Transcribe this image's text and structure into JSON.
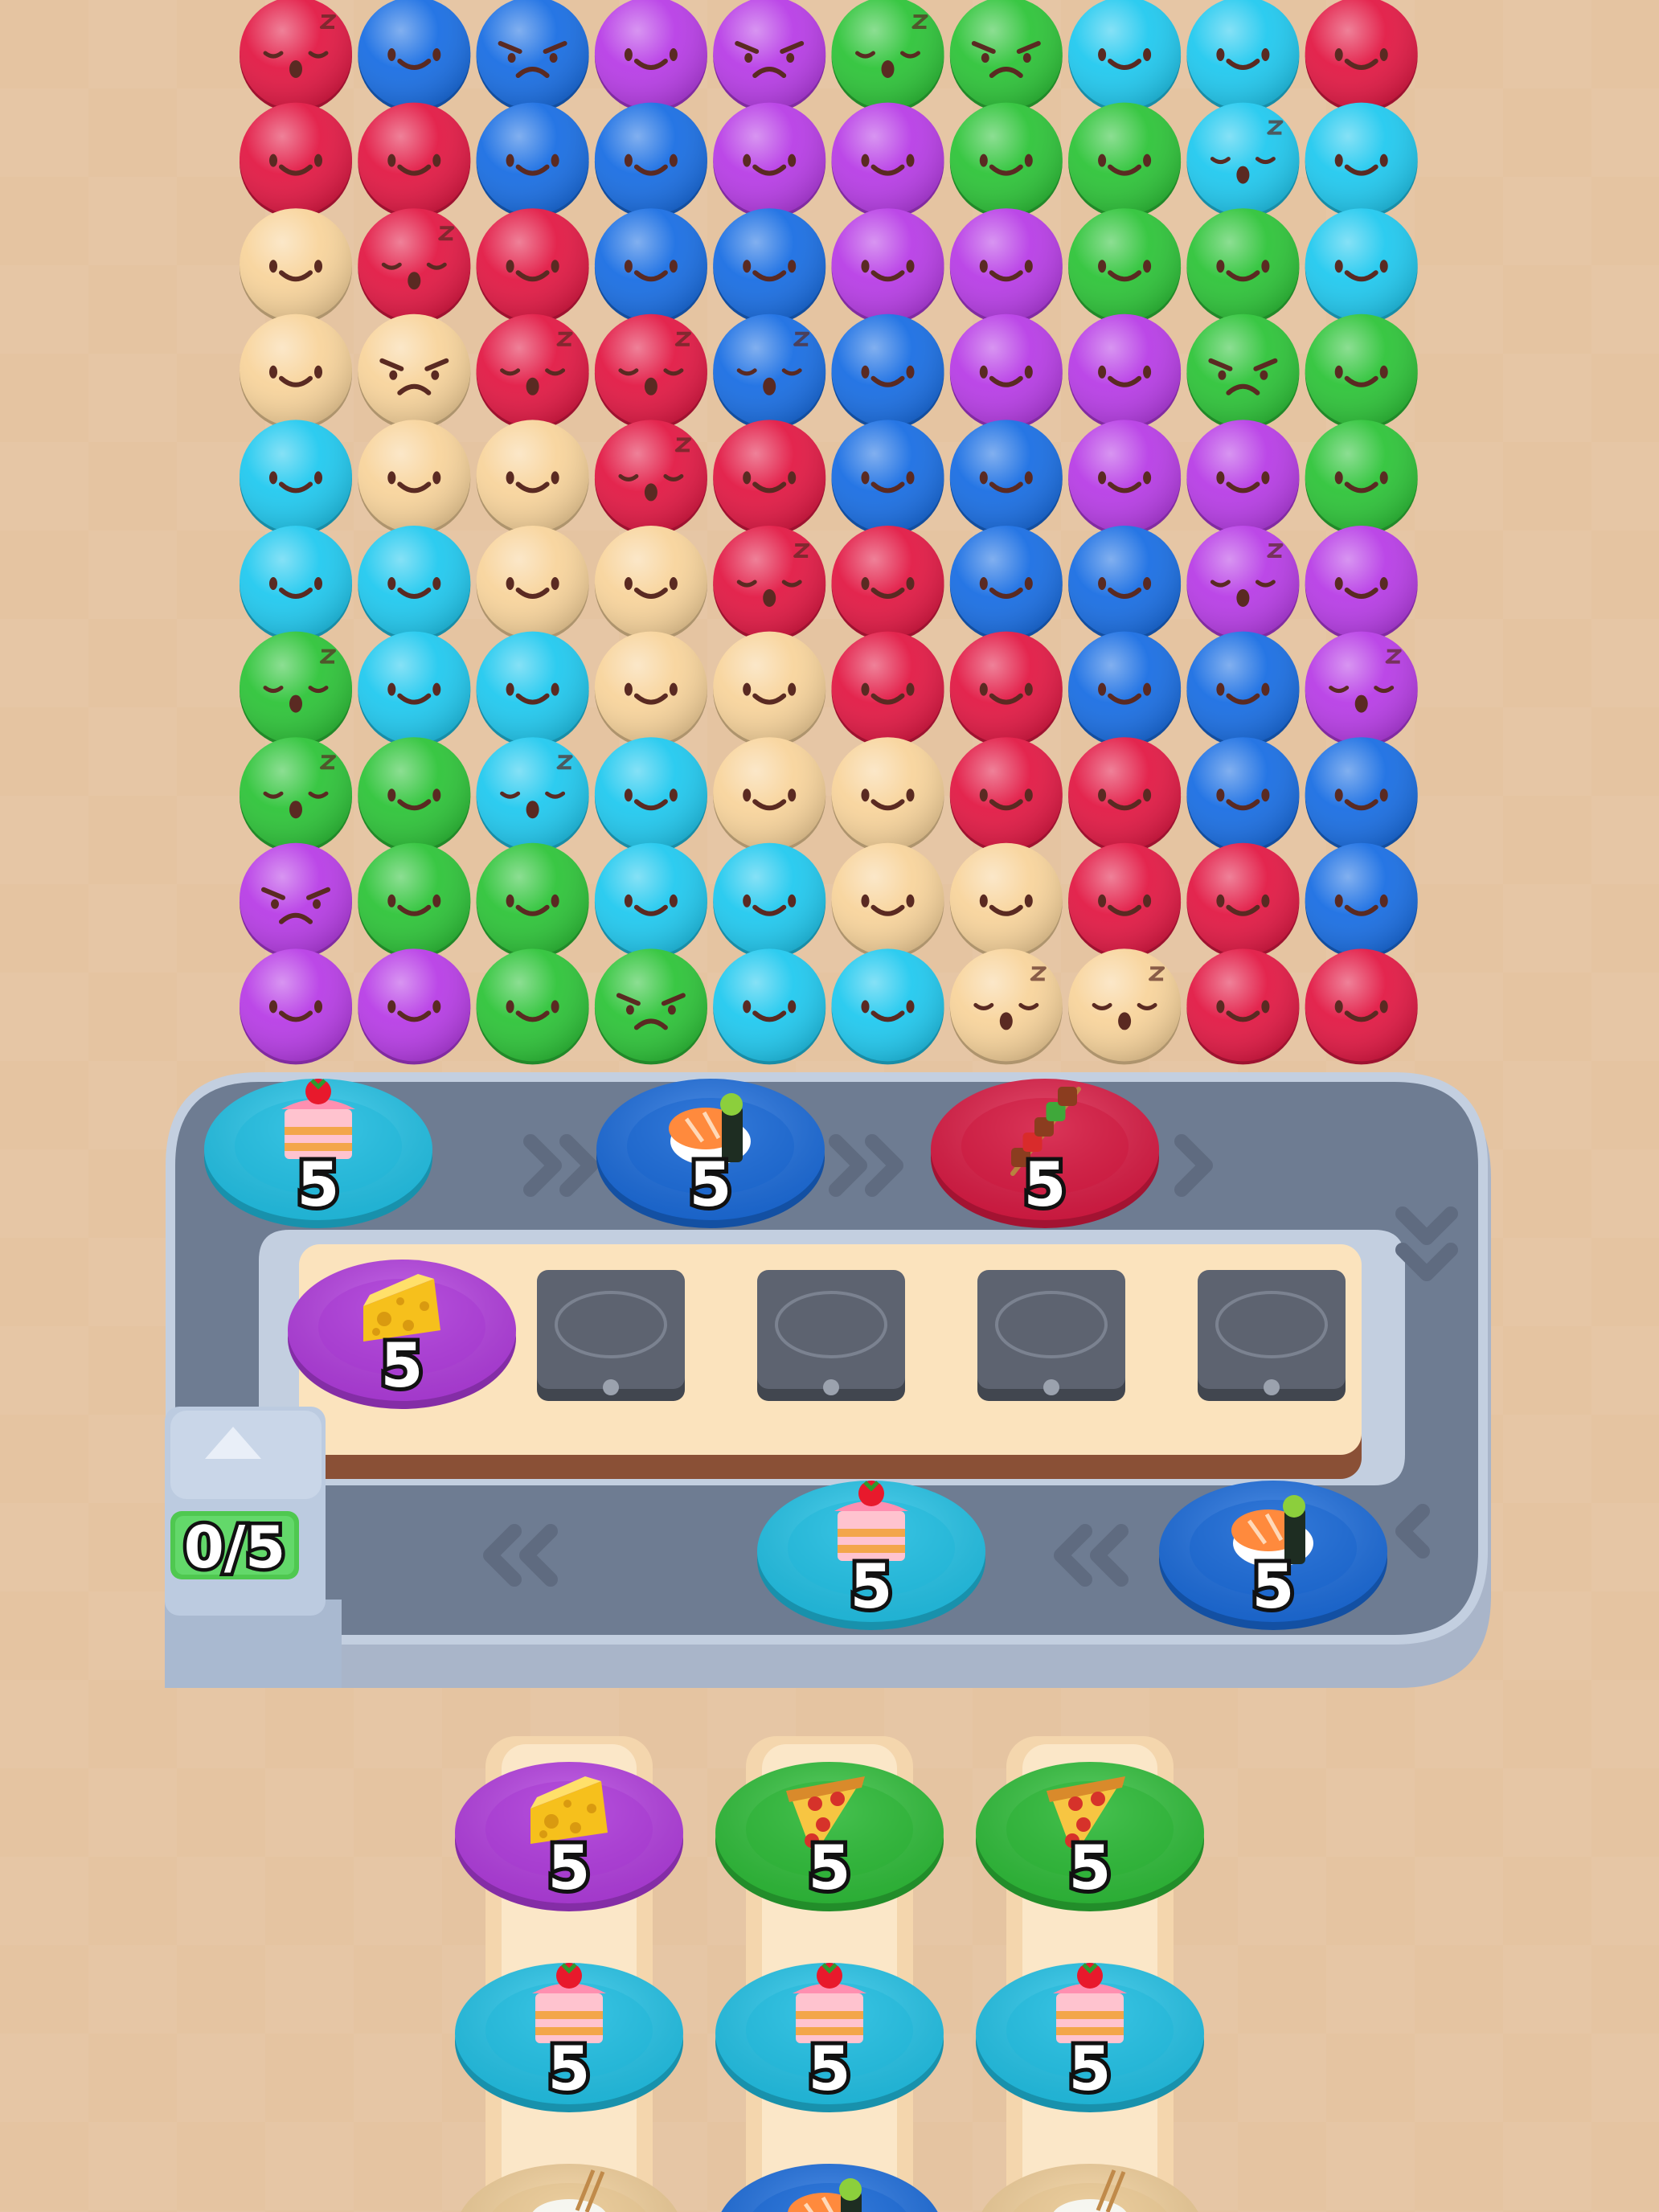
{
  "palette": {
    "red": "#e21a45",
    "blue": "#1b6fe3",
    "purple": "#b83ee6",
    "green": "#2fc43a",
    "cyan": "#22c9ef",
    "yellow": "#f8d49c",
    "background": "#e5c4a1",
    "belt": "#6e7c92",
    "belt_rail": "#b9c6da",
    "tray": "#fbe3bd",
    "empty_slot": "#5d6370"
  },
  "board": {
    "columns": 10,
    "rows": [
      [
        "red",
        "blue",
        "blue",
        "purple",
        "purple",
        "green",
        "green",
        "cyan",
        "cyan",
        "red"
      ],
      [
        "red",
        "red",
        "blue",
        "blue",
        "purple",
        "purple",
        "green",
        "green",
        "cyan",
        "cyan"
      ],
      [
        "yellow",
        "red",
        "red",
        "blue",
        "blue",
        "purple",
        "purple",
        "green",
        "green",
        "cyan"
      ],
      [
        "yellow",
        "yellow",
        "red",
        "red",
        "blue",
        "blue",
        "purple",
        "purple",
        "green",
        "green"
      ],
      [
        "cyan",
        "yellow",
        "yellow",
        "red",
        "red",
        "blue",
        "blue",
        "purple",
        "purple",
        "green"
      ],
      [
        "cyan",
        "cyan",
        "yellow",
        "yellow",
        "red",
        "red",
        "blue",
        "blue",
        "purple",
        "purple"
      ],
      [
        "green",
        "cyan",
        "cyan",
        "yellow",
        "yellow",
        "red",
        "red",
        "blue",
        "blue",
        "purple"
      ],
      [
        "green",
        "green",
        "cyan",
        "cyan",
        "yellow",
        "yellow",
        "red",
        "red",
        "blue",
        "blue"
      ],
      [
        "purple",
        "green",
        "green",
        "cyan",
        "cyan",
        "yellow",
        "yellow",
        "red",
        "red",
        "blue"
      ],
      [
        "purple",
        "purple",
        "green",
        "green",
        "cyan",
        "cyan",
        "yellow",
        "yellow",
        "red",
        "red"
      ]
    ],
    "faces": [
      [
        "sleepy",
        "smile",
        "angry",
        "smile",
        "angry",
        "sleepy",
        "angry",
        "smile",
        "smile",
        "smile"
      ],
      [
        "smile",
        "smile",
        "smile",
        "smile",
        "smile",
        "smile",
        "smile",
        "smile",
        "sleepy",
        "smile"
      ],
      [
        "smile",
        "sleepy",
        "smile",
        "smile",
        "smile",
        "smile",
        "smile",
        "smile",
        "smile",
        "smile"
      ],
      [
        "smile",
        "angry",
        "sleepy",
        "sleepy",
        "sleepy",
        "smile",
        "smile",
        "smile",
        "angry",
        "smile"
      ],
      [
        "smile",
        "smile",
        "smile",
        "sleepy",
        "smile",
        "smile",
        "smile",
        "smile",
        "smile",
        "smile"
      ],
      [
        "smile",
        "smile",
        "smile",
        "smile",
        "sleepy",
        "smile",
        "smile",
        "smile",
        "sleepy",
        "smile"
      ],
      [
        "sleepy",
        "smile",
        "smile",
        "smile",
        "smile",
        "smile",
        "smile",
        "smile",
        "smile",
        "sleepy"
      ],
      [
        "sleepy",
        "smile",
        "sleepy",
        "smile",
        "smile",
        "smile",
        "smile",
        "smile",
        "smile",
        "smile"
      ],
      [
        "angry",
        "smile",
        "smile",
        "smile",
        "smile",
        "smile",
        "smile",
        "smile",
        "smile",
        "smile"
      ],
      [
        "smile",
        "smile",
        "smile",
        "angry",
        "smile",
        "smile",
        "sleepy",
        "sleepy",
        "smile",
        "smile"
      ]
    ]
  },
  "belt_plates": [
    {
      "food": "cake-icon",
      "color": "cyan",
      "count": "5"
    },
    {
      "food": "sushi-icon",
      "color": "blue",
      "count": "5"
    },
    {
      "food": "kebab-icon",
      "color": "red",
      "count": "5"
    },
    {
      "food": "cake-icon",
      "color": "cyan",
      "count": "5"
    },
    {
      "food": "sushi-icon",
      "color": "blue",
      "count": "5"
    }
  ],
  "tray": {
    "filled": [
      {
        "food": "cheese-icon",
        "color": "purple",
        "count": "5"
      }
    ],
    "empty_slots": 4
  },
  "counter": {
    "label": "0/5"
  },
  "queue_columns": [
    [
      {
        "food": "cheese-icon",
        "color": "purple",
        "count": "5"
      },
      {
        "food": "cake-icon",
        "color": "cyan",
        "count": "5"
      },
      {
        "food": "rice-bowl-icon",
        "color": "yellow",
        "count": ""
      }
    ],
    [
      {
        "food": "pizza-icon",
        "color": "green",
        "count": "5"
      },
      {
        "food": "cake-icon",
        "color": "cyan",
        "count": "5"
      },
      {
        "food": "sushi-icon",
        "color": "blue",
        "count": ""
      }
    ],
    [
      {
        "food": "pizza-icon",
        "color": "green",
        "count": "5"
      },
      {
        "food": "cake-icon",
        "color": "cyan",
        "count": "5"
      },
      {
        "food": "rice-bowl-icon",
        "color": "yellow",
        "count": ""
      }
    ]
  ]
}
